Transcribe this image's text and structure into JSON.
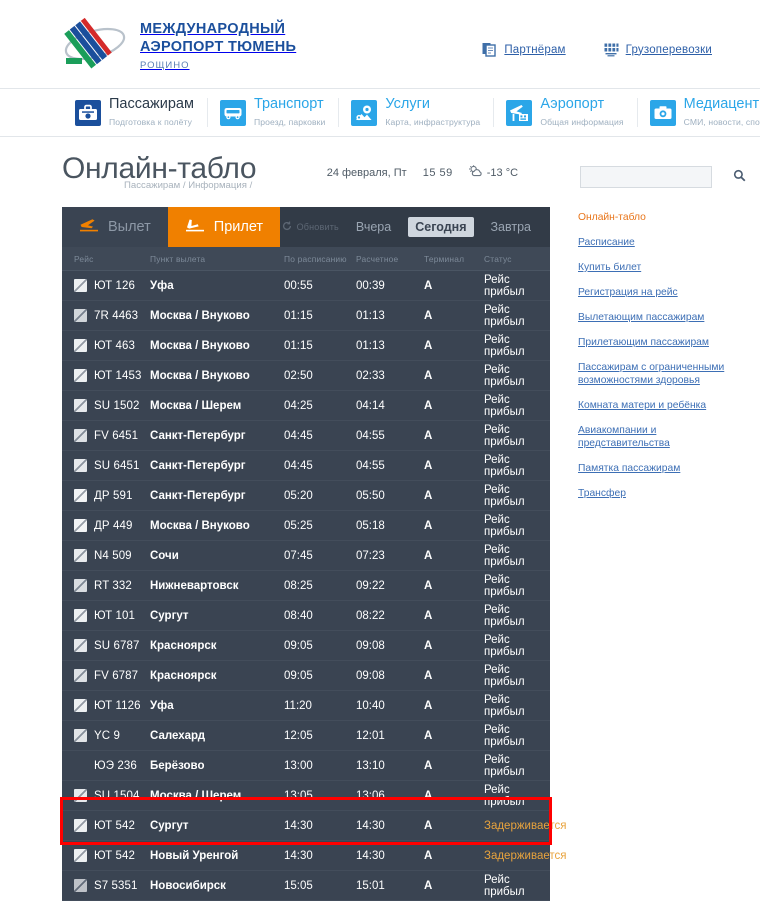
{
  "brand": {
    "line1": "МЕЖДУНАРОДНЫЙ",
    "line2": "АЭРОПОРТ ТЮМЕНЬ",
    "sub": "РОЩИНО"
  },
  "top_links": [
    {
      "label": "Партнёрам",
      "icon": "partners-icon"
    },
    {
      "label": "Грузоперевозки",
      "icon": "cargo-icon"
    }
  ],
  "nav": [
    {
      "title": "Пассажирам",
      "desc": "Подготовка к полёту",
      "icon": "suitcase-icon",
      "active": true
    },
    {
      "title": "Транспорт",
      "desc": "Проезд, парковки",
      "icon": "bus-icon",
      "active": false
    },
    {
      "title": "Услуги",
      "desc": "Карта, инфраструктура",
      "icon": "services-icon",
      "active": false
    },
    {
      "title": "Аэропорт",
      "desc": "Общая информация",
      "icon": "airport-icon",
      "active": false
    },
    {
      "title": "Медиацентр",
      "desc": "СМИ, новости, спотти н",
      "icon": "camera-icon",
      "active": false
    }
  ],
  "page": {
    "title": "Онлайн-табло",
    "date": "24 февраля, Пт",
    "time": "15 59",
    "temperature": "-13 °C",
    "weather_icon": "cloud-sun-icon",
    "breadcrumb": "Пассажирам / Информация /"
  },
  "search": {
    "value": "",
    "placeholder": "",
    "icon": "search-icon"
  },
  "board": {
    "tabs": [
      {
        "label": "Вылет",
        "icon": "departure-icon",
        "active": false
      },
      {
        "label": "Прилет",
        "icon": "arrival-icon",
        "active": true
      }
    ],
    "refresh_label": "Обновить",
    "refresh_icon": "refresh-icon",
    "days": [
      {
        "label": "Вчера",
        "active": false
      },
      {
        "label": "Сегодня",
        "active": true
      },
      {
        "label": "Завтра",
        "active": false
      }
    ],
    "columns": [
      "Рейс",
      "Пункт вылета",
      "По расписанию",
      "Расчетное",
      "Терминал",
      "Статус"
    ],
    "accent_color": "#f08000",
    "delay_color": "#e8a33d",
    "highlight_color": "#ff0000",
    "rows": [
      {
        "icon_color": "#d8dde2",
        "flight": "ЮТ 126",
        "from": "Уфа",
        "scheduled": "00:55",
        "estimated": "00:39",
        "terminal": "A",
        "status": "Рейс прибыл",
        "delayed": false
      },
      {
        "icon_color": "#9aa4ae",
        "flight": "7R 4463",
        "from": "Москва / Внуково",
        "scheduled": "01:15",
        "estimated": "01:13",
        "terminal": "A",
        "status": "Рейс прибыл",
        "delayed": false
      },
      {
        "icon_color": "#d8dde2",
        "flight": "ЮТ 463",
        "from": "Москва / Внуково",
        "scheduled": "01:15",
        "estimated": "01:13",
        "terminal": "A",
        "status": "Рейс прибыл",
        "delayed": false
      },
      {
        "icon_color": "#d8dde2",
        "flight": "ЮТ 1453",
        "from": "Москва / Внуково",
        "scheduled": "02:50",
        "estimated": "02:33",
        "terminal": "A",
        "status": "Рейс прибыл",
        "delayed": false
      },
      {
        "icon_color": "#c8ced5",
        "flight": "SU 1502",
        "from": "Москва / Шерем",
        "scheduled": "04:25",
        "estimated": "04:14",
        "terminal": "A",
        "status": "Рейс прибыл",
        "delayed": false
      },
      {
        "icon_color": "#b4bcc5",
        "flight": "FV 6451",
        "from": "Санкт-Петербург",
        "scheduled": "04:45",
        "estimated": "04:55",
        "terminal": "A",
        "status": "Рейс прибыл",
        "delayed": false
      },
      {
        "icon_color": "#c8ced5",
        "flight": "SU 6451",
        "from": "Санкт-Петербург",
        "scheduled": "04:45",
        "estimated": "04:55",
        "terminal": "A",
        "status": "Рейс прибыл",
        "delayed": false
      },
      {
        "icon_color": "#e3e7ea",
        "flight": "ДР 591",
        "from": "Санкт-Петербург",
        "scheduled": "05:20",
        "estimated": "05:50",
        "terminal": "A",
        "status": "Рейс прибыл",
        "delayed": false
      },
      {
        "icon_color": "#e3e7ea",
        "flight": "ДР 449",
        "from": "Москва / Внуково",
        "scheduled": "05:25",
        "estimated": "05:18",
        "terminal": "A",
        "status": "Рейс прибыл",
        "delayed": false
      },
      {
        "icon_color": "#cdd3d9",
        "flight": "N4 509",
        "from": "Сочи",
        "scheduled": "07:45",
        "estimated": "07:23",
        "terminal": "A",
        "status": "Рейс прибыл",
        "delayed": false
      },
      {
        "icon_color": "#aab3bd",
        "flight": "RT 332",
        "from": "Нижневартовск",
        "scheduled": "08:25",
        "estimated": "09:22",
        "terminal": "A",
        "status": "Рейс прибыл",
        "delayed": false
      },
      {
        "icon_color": "#d8dde2",
        "flight": "ЮТ 101",
        "from": "Сургут",
        "scheduled": "08:40",
        "estimated": "08:22",
        "terminal": "A",
        "status": "Рейс прибыл",
        "delayed": false
      },
      {
        "icon_color": "#c8ced5",
        "flight": "SU 6787",
        "from": "Красноярск",
        "scheduled": "09:05",
        "estimated": "09:08",
        "terminal": "A",
        "status": "Рейс прибыл",
        "delayed": false
      },
      {
        "icon_color": "#b4bcc5",
        "flight": "FV 6787",
        "from": "Красноярск",
        "scheduled": "09:05",
        "estimated": "09:08",
        "terminal": "A",
        "status": "Рейс прибыл",
        "delayed": false
      },
      {
        "icon_color": "#d8dde2",
        "flight": "ЮТ 1126",
        "from": "Уфа",
        "scheduled": "11:20",
        "estimated": "10:40",
        "terminal": "A",
        "status": "Рейс прибыл",
        "delayed": false
      },
      {
        "icon_color": "#bfc6cd",
        "flight": "YC 9",
        "from": "Салехард",
        "scheduled": "12:05",
        "estimated": "12:01",
        "terminal": "A",
        "status": "Рейс прибыл",
        "delayed": false
      },
      {
        "icon_color": "",
        "flight": "ЮЭ 236",
        "from": "Берёзово",
        "scheduled": "13:00",
        "estimated": "13:10",
        "terminal": "A",
        "status": "Рейс прибыл",
        "delayed": false
      },
      {
        "icon_color": "#c8ced5",
        "flight": "SU 1504",
        "from": "Москва / Шерем",
        "scheduled": "13:05",
        "estimated": "13:06",
        "terminal": "A",
        "status": "Рейс прибыл",
        "delayed": false
      },
      {
        "icon_color": "#d8dde2",
        "flight": "ЮТ 542",
        "from": "Сургут",
        "scheduled": "14:30",
        "estimated": "14:30",
        "terminal": "A",
        "status": "Задерживается",
        "delayed": true
      },
      {
        "icon_color": "#d8dde2",
        "flight": "ЮТ 542",
        "from": "Новый Уренгой",
        "scheduled": "14:30",
        "estimated": "14:30",
        "terminal": "A",
        "status": "Задерживается",
        "delayed": true
      },
      {
        "icon_color": "#6e7784",
        "flight": "S7 5351",
        "from": "Новосибирск",
        "scheduled": "15:05",
        "estimated": "15:01",
        "terminal": "A",
        "status": "Рейс прибыл",
        "delayed": false
      }
    ]
  },
  "sidebar": {
    "items": [
      {
        "label": "Онлайн-табло",
        "current": true
      },
      {
        "label": "Расписание",
        "current": false
      },
      {
        "label": "Купить билет",
        "current": false
      },
      {
        "label": "Регистрация на рейс",
        "current": false
      },
      {
        "label": "Вылетающим пассажирам",
        "current": false
      },
      {
        "label": "Прилетающим пассажирам",
        "current": false
      },
      {
        "label": "Пассажирам с ограниченными возможностями здоровья",
        "current": false
      },
      {
        "label": "Комната матери и ребёнка",
        "current": false
      },
      {
        "label": "Авиакомпании и представительства",
        "current": false
      },
      {
        "label": "Памятка пассажирам",
        "current": false
      },
      {
        "label": "Трансфер",
        "current": false
      }
    ]
  }
}
